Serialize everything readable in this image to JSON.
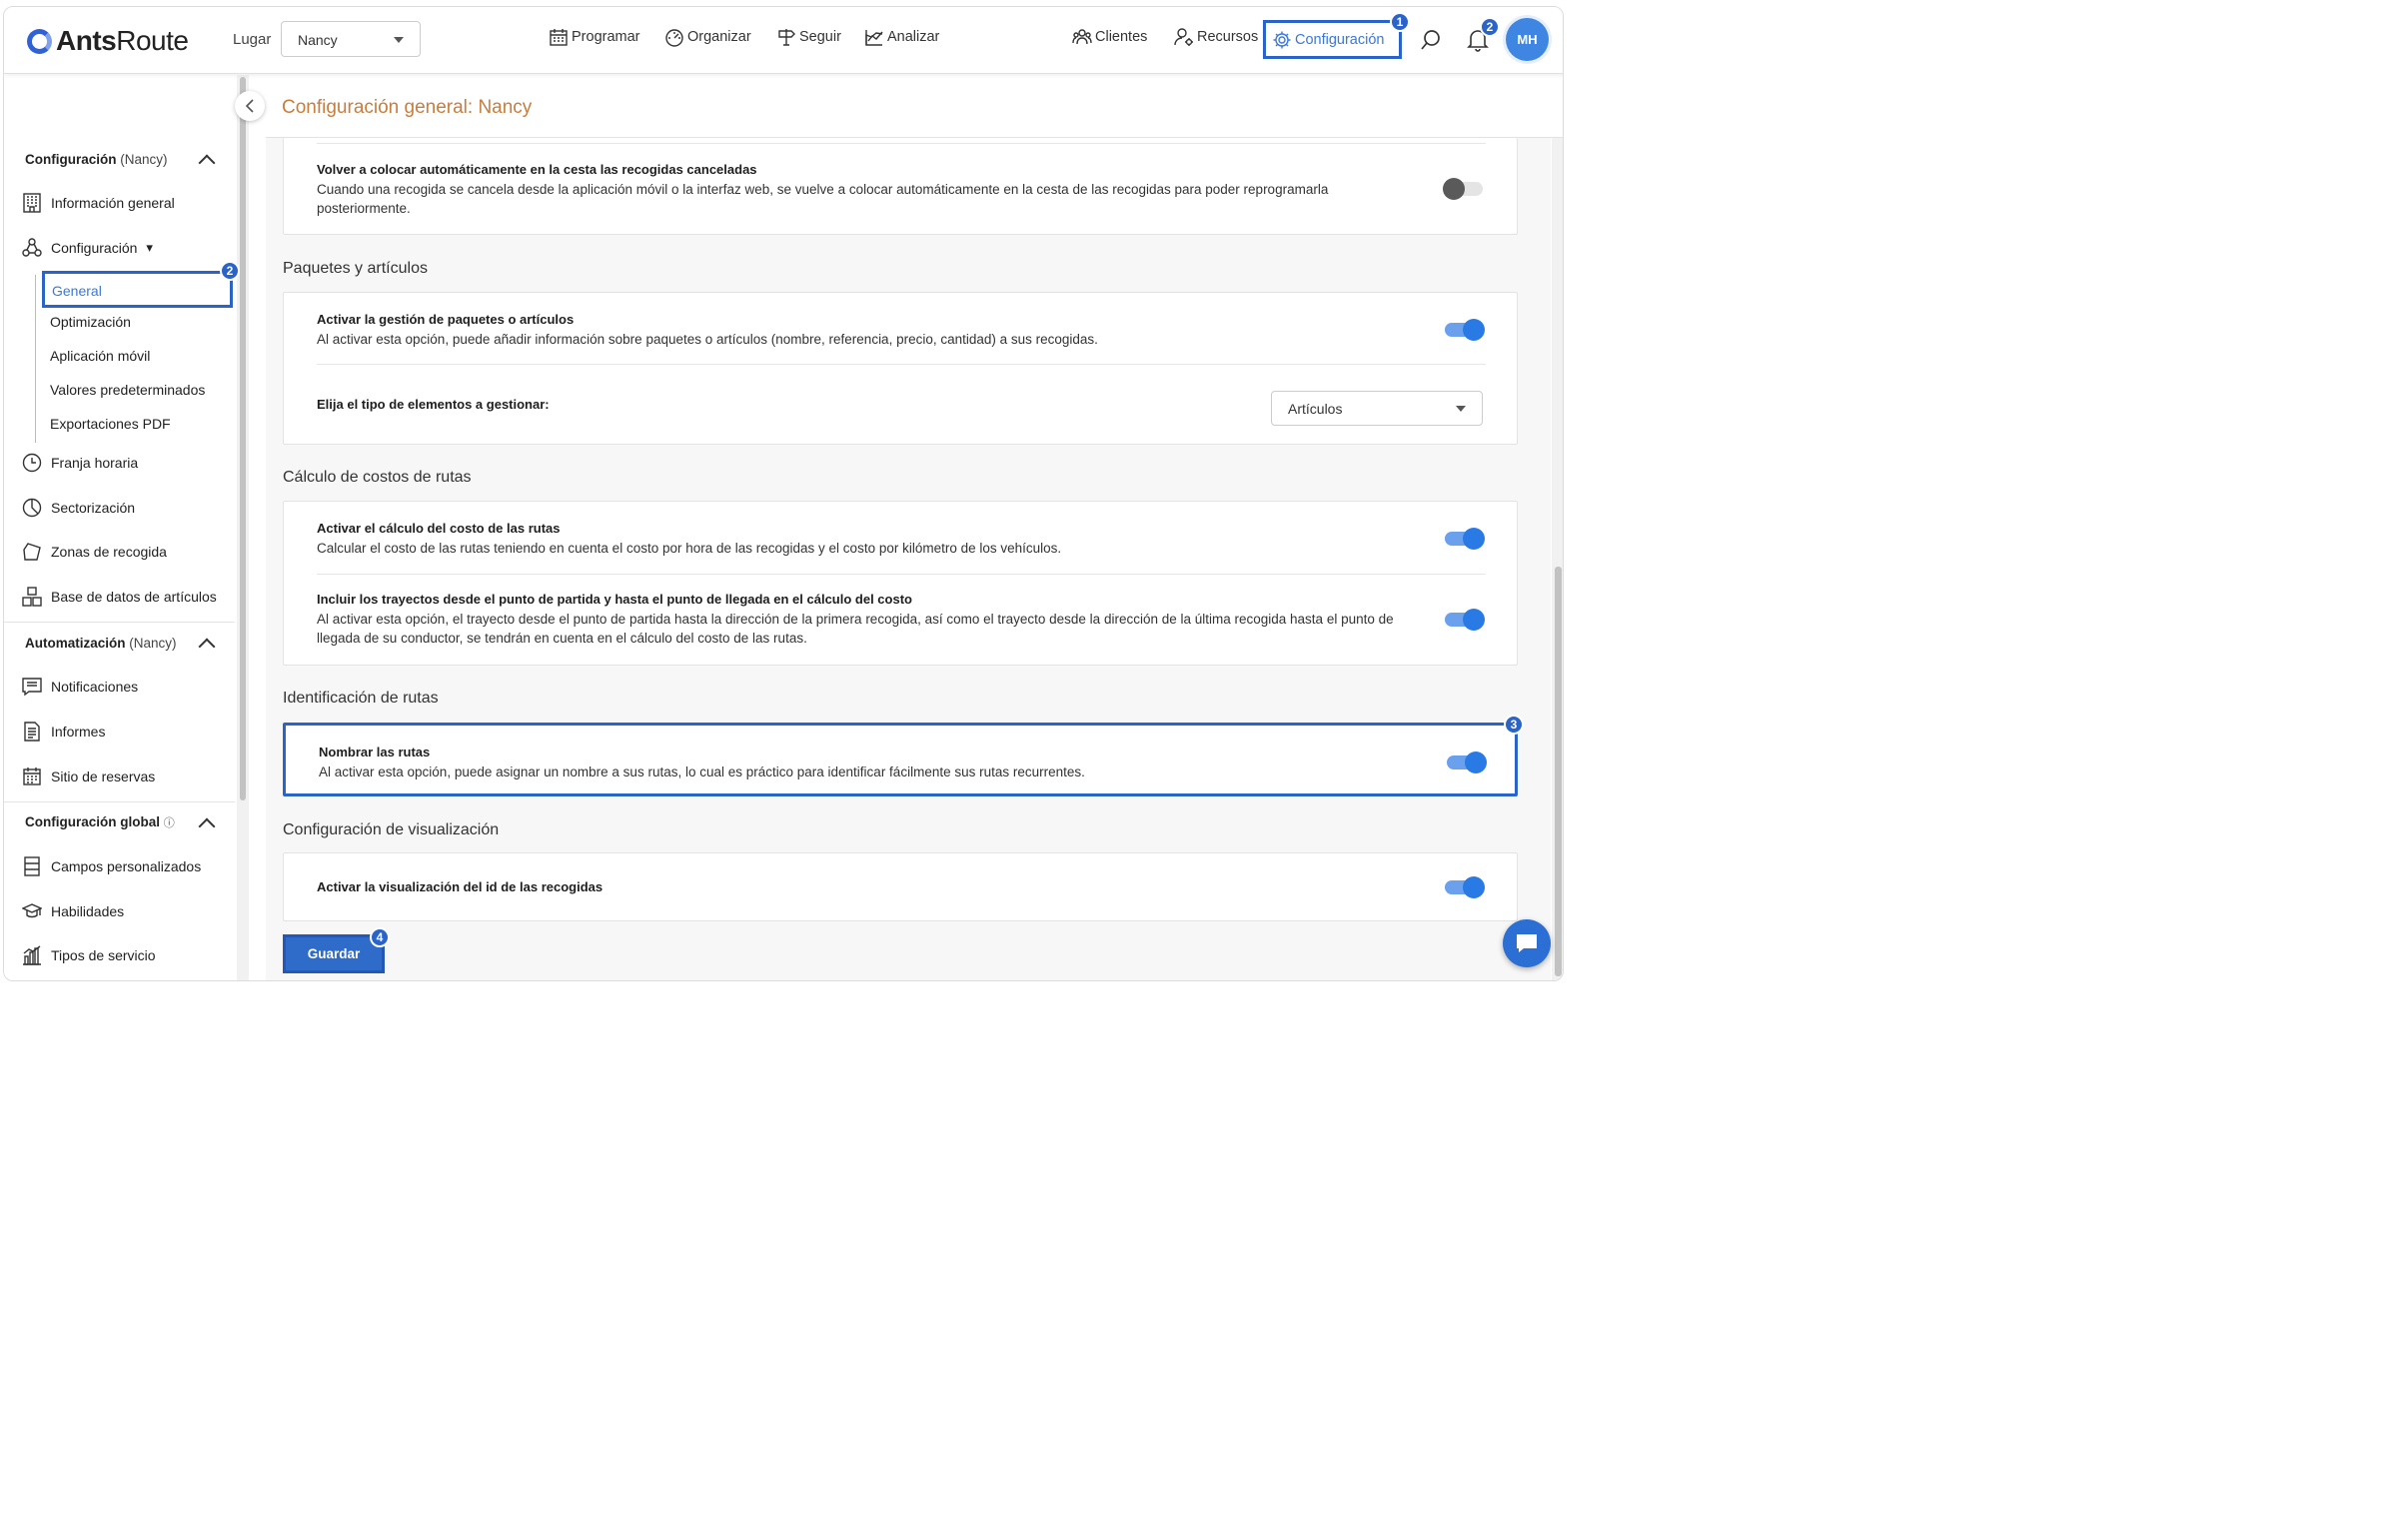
{
  "header": {
    "logo_bold": "Ants",
    "logo_rest": "Route",
    "lugar_label": "Lugar",
    "lugar_value": "Nancy",
    "nav": {
      "programar": "Programar",
      "organizar": "Organizar",
      "seguir": "Seguir",
      "analizar": "Analizar",
      "clientes": "Clientes",
      "recursos": "Recursos",
      "configuracion": "Configuración"
    },
    "config_badge": "1",
    "notif_badge": "2",
    "avatar": "MH"
  },
  "sidebar": {
    "sec1_bold": "Configuración",
    "sec1_rest": "(Nancy)",
    "info_general": "Información general",
    "configuracion": "Configuración",
    "config_arrow": "▾",
    "general": "General",
    "general_badge": "2",
    "optimizacion": "Optimización",
    "app_movil": "Aplicación móvil",
    "valores": "Valores predeterminados",
    "export_pdf": "Exportaciones PDF",
    "franja": "Franja horaria",
    "sectorizacion": "Sectorización",
    "zonas": "Zonas de recogida",
    "base_datos": "Base de datos de artículos",
    "sec2_bold": "Automatización",
    "sec2_rest": "(Nancy)",
    "notificaciones": "Notificaciones",
    "informes": "Informes",
    "sitio": "Sitio de reservas",
    "sec3_bold": "Configuración global",
    "sec3_info": "ⓘ",
    "campos": "Campos personalizados",
    "habilidades": "Habilidades",
    "tipos": "Tipos de servicio"
  },
  "main": {
    "title": "Configuración general: Nancy",
    "card0": {
      "title": "Volver a colocar automáticamente en la cesta las recogidas canceladas",
      "desc": "Cuando una recogida se cancela desde la aplicación móvil o la interfaz web, se vuelve a colocar automáticamente en la cesta de las recogidas para poder reprogramarla posteriormente.",
      "toggle_on": false
    },
    "sec_paquetes": "Paquetes y artículos",
    "paq_title": "Activar la gestión de paquetes o artículos",
    "paq_desc": "Al activar esta opción, puede añadir información sobre paquetes o artículos (nombre, referencia, precio, cantidad) a sus recogidas.",
    "paq_type_label": "Elija el tipo de elementos a gestionar:",
    "paq_type_value": "Artículos",
    "sec_costos": "Cálculo de costos de rutas",
    "cost1_title": "Activar el cálculo del costo de las rutas",
    "cost1_desc": "Calcular el costo de las rutas teniendo en cuenta el costo por hora de las recogidas y el costo por kilómetro de los vehículos.",
    "cost2_title": "Incluir los trayectos desde el punto de partida y hasta el punto de llegada en el cálculo del costo",
    "cost2_desc": "Al activar esta opción, el trayecto desde el punto de partida hasta la dirección de la primera recogida, así como el trayecto desde la dirección de la última recogida hasta el punto de llegada de su conductor, se tendrán en cuenta en el cálculo del costo de las rutas.",
    "sec_ident": "Identificación de rutas",
    "ident_title": "Nombrar las rutas",
    "ident_desc": "Al activar esta opción, puede asignar un nombre a sus rutas, lo cual es práctico para identificar fácilmente sus rutas recurrentes.",
    "ident_badge": "3",
    "sec_visual": "Configuración de visualización",
    "visual_title": "Activar la visualización del id de las recogidas",
    "save": "Guardar",
    "save_badge": "4"
  },
  "colors": {
    "accent": "#2a64c8",
    "title_orange": "#c87d3e",
    "toggle_on": "#2a7ae6"
  }
}
